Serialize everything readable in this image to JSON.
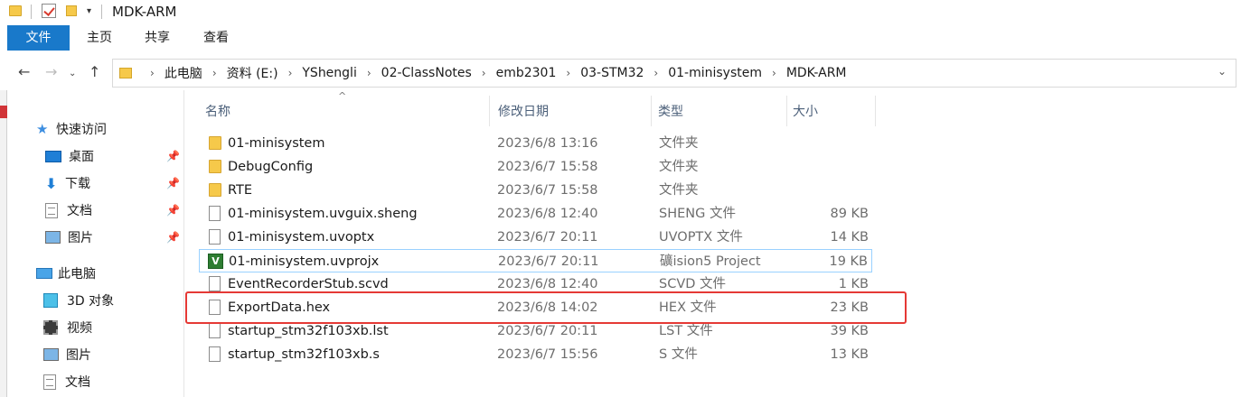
{
  "window": {
    "title": "MDK-ARM"
  },
  "ribbon": {
    "tabs": [
      "文件",
      "主页",
      "共享",
      "查看"
    ]
  },
  "address": {
    "crumbs": [
      "此电脑",
      "资料 (E:)",
      "YShengli",
      "02-ClassNotes",
      "emb2301",
      "03-STM32",
      "01-minisystem",
      "MDK-ARM"
    ]
  },
  "nav": {
    "quick_access": "快速访问",
    "items_quick": [
      "桌面",
      "下载",
      "文档",
      "图片"
    ],
    "this_pc": "此电脑",
    "items_pc": [
      "3D 对象",
      "视频",
      "图片",
      "文档"
    ]
  },
  "columns": {
    "name": "名称",
    "date": "修改日期",
    "type": "类型",
    "size": "大小"
  },
  "files": [
    {
      "name": "01-minisystem",
      "date": "2023/6/8 13:16",
      "type": "文件夹",
      "size": "",
      "icon": "folder-icon"
    },
    {
      "name": "DebugConfig",
      "date": "2023/6/7 15:58",
      "type": "文件夹",
      "size": "",
      "icon": "folder-icon"
    },
    {
      "name": "RTE",
      "date": "2023/6/7 15:58",
      "type": "文件夹",
      "size": "",
      "icon": "folder-icon"
    },
    {
      "name": "01-minisystem.uvguix.sheng",
      "date": "2023/6/8 12:40",
      "type": "SHENG 文件",
      "size": "89 KB",
      "icon": "file-icon"
    },
    {
      "name": "01-minisystem.uvoptx",
      "date": "2023/6/7 20:11",
      "type": "UVOPTX 文件",
      "size": "14 KB",
      "icon": "file-icon"
    },
    {
      "name": "01-minisystem.uvprojx",
      "date": "2023/6/7 20:11",
      "type": "礦ision5 Project",
      "size": "19 KB",
      "icon": "uvision-project-icon"
    },
    {
      "name": "EventRecorderStub.scvd",
      "date": "2023/6/8 12:40",
      "type": "SCVD 文件",
      "size": "1 KB",
      "icon": "file-icon"
    },
    {
      "name": "ExportData.hex",
      "date": "2023/6/8 14:02",
      "type": "HEX 文件",
      "size": "23 KB",
      "icon": "file-icon"
    },
    {
      "name": "startup_stm32f103xb.lst",
      "date": "2023/6/7 20:11",
      "type": "LST 文件",
      "size": "39 KB",
      "icon": "file-icon"
    },
    {
      "name": "startup_stm32f103xb.s",
      "date": "2023/6/7 15:56",
      "type": "S 文件",
      "size": "13 KB",
      "icon": "file-icon"
    }
  ],
  "colors": {
    "file_tab": "#1979ca",
    "highlight_box": "#e53935",
    "selection_border": "#99d1ff"
  }
}
